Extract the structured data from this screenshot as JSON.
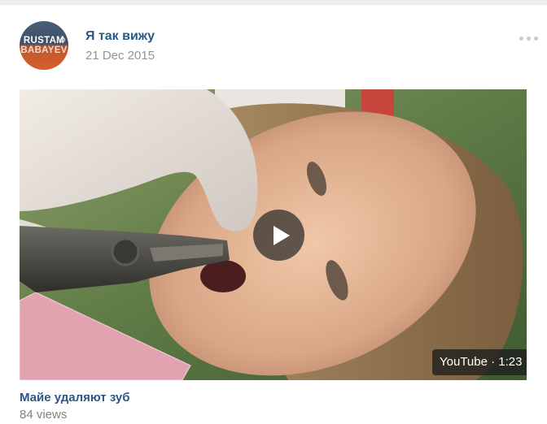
{
  "post": {
    "author": "Я так вижу",
    "date": "21 Dec 2015",
    "avatar": {
      "line1": "RUSTAM",
      "line2": "BABAYEV"
    },
    "more_icon": "more-dots-icon"
  },
  "video": {
    "badge": "YouTube · 1:23",
    "title": "Майе удаляют зуб",
    "views": "84 views",
    "play_icon": "play-icon"
  },
  "colors": {
    "link": "#2a5885",
    "meta": "#939393",
    "page_bg": "#edeef0"
  }
}
